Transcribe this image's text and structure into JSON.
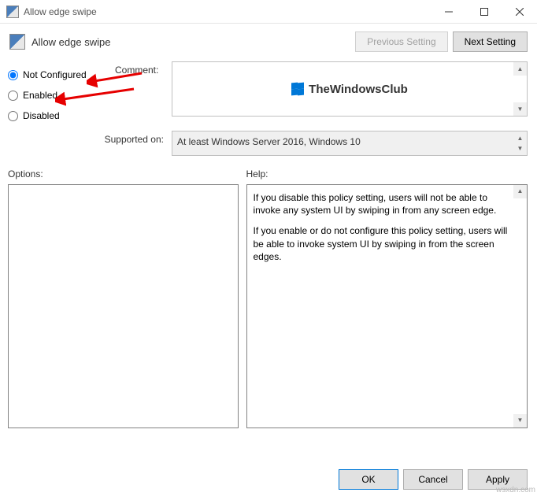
{
  "window": {
    "title": "Allow edge swipe"
  },
  "header": {
    "title": "Allow edge swipe",
    "previous_btn": "Previous Setting",
    "next_btn": "Next Setting"
  },
  "radios": {
    "not_configured": "Not Configured",
    "enabled": "Enabled",
    "disabled": "Disabled",
    "selected": "not_configured"
  },
  "comment": {
    "label": "Comment:",
    "watermark": "TheWindowsClub"
  },
  "supported": {
    "label": "Supported on:",
    "value": "At least Windows Server 2016, Windows 10"
  },
  "panes": {
    "options_label": "Options:",
    "help_label": "Help:",
    "help_p1": "If you disable this policy setting, users will not be able to invoke any system UI by swiping in from any screen edge.",
    "help_p2": "If you enable or do not configure this policy setting, users will be able to invoke system UI by swiping in from the screen edges."
  },
  "footer": {
    "ok": "OK",
    "cancel": "Cancel",
    "apply": "Apply"
  },
  "watermark_site": "wsxdn.com"
}
